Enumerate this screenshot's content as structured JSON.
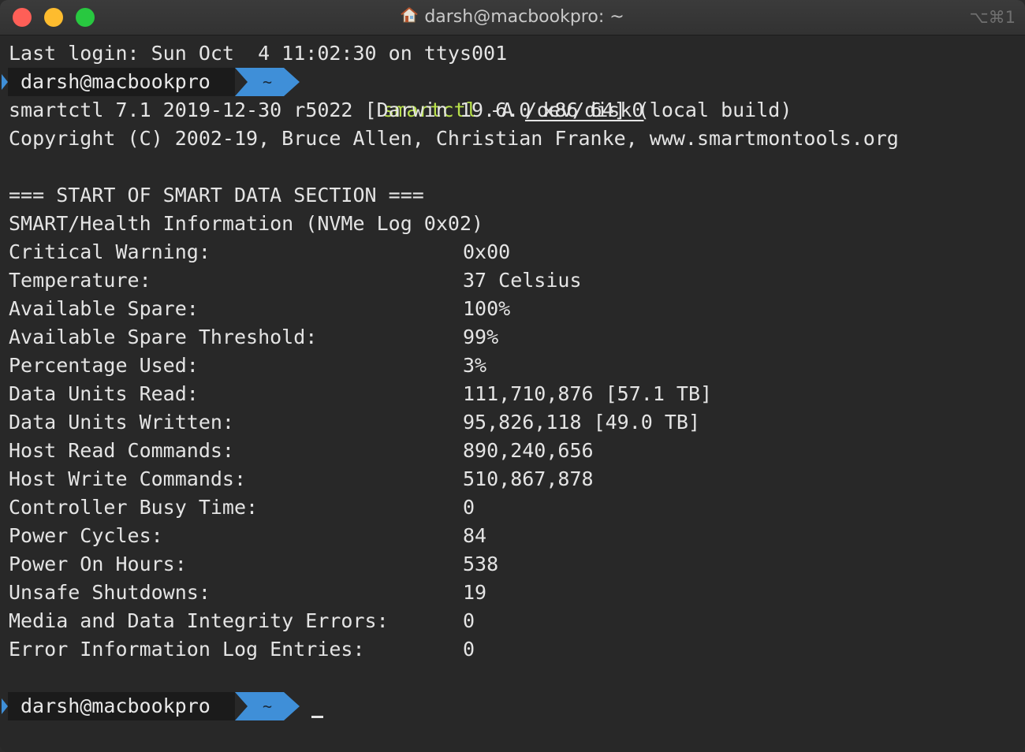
{
  "window": {
    "title": "darsh@macbookpro: ~",
    "shortcut": "⌥⌘1"
  },
  "terminal": {
    "last_login": "Last login: Sun Oct  4 11:02:30 on ttys001",
    "prompt": {
      "user": "darsh@macbookpro",
      "dir": "~"
    },
    "command": {
      "name": "smartctl",
      "flag": " -A ",
      "path": "/dev/disk0"
    },
    "header_lines": [
      "smartctl 7.1 2019-12-30 r5022 [Darwin 19.6.0 x86_64] (local build)",
      "Copyright (C) 2002-19, Bruce Allen, Christian Franke, www.smartmontools.org"
    ],
    "section_start": "=== START OF SMART DATA SECTION ===",
    "section_title": "SMART/Health Information (NVMe Log 0x02)",
    "rows": [
      {
        "key": "Critical Warning:",
        "value": "0x00"
      },
      {
        "key": "Temperature:",
        "value": "37 Celsius"
      },
      {
        "key": "Available Spare:",
        "value": "100%"
      },
      {
        "key": "Available Spare Threshold:",
        "value": "99%"
      },
      {
        "key": "Percentage Used:",
        "value": "3%"
      },
      {
        "key": "Data Units Read:",
        "value": "111,710,876 [57.1 TB]"
      },
      {
        "key": "Data Units Written:",
        "value": "95,826,118 [49.0 TB]"
      },
      {
        "key": "Host Read Commands:",
        "value": "890,240,656"
      },
      {
        "key": "Host Write Commands:",
        "value": "510,867,878"
      },
      {
        "key": "Controller Busy Time:",
        "value": "0"
      },
      {
        "key": "Power Cycles:",
        "value": "84"
      },
      {
        "key": "Power On Hours:",
        "value": "538"
      },
      {
        "key": "Unsafe Shutdowns:",
        "value": "19"
      },
      {
        "key": "Media and Data Integrity Errors:",
        "value": "0"
      },
      {
        "key": "Error Information Log Entries:",
        "value": "0"
      }
    ]
  },
  "colors": {
    "prompt_accent": "#3f8fd8",
    "command_name": "#b8e04a",
    "background": "#282828"
  }
}
